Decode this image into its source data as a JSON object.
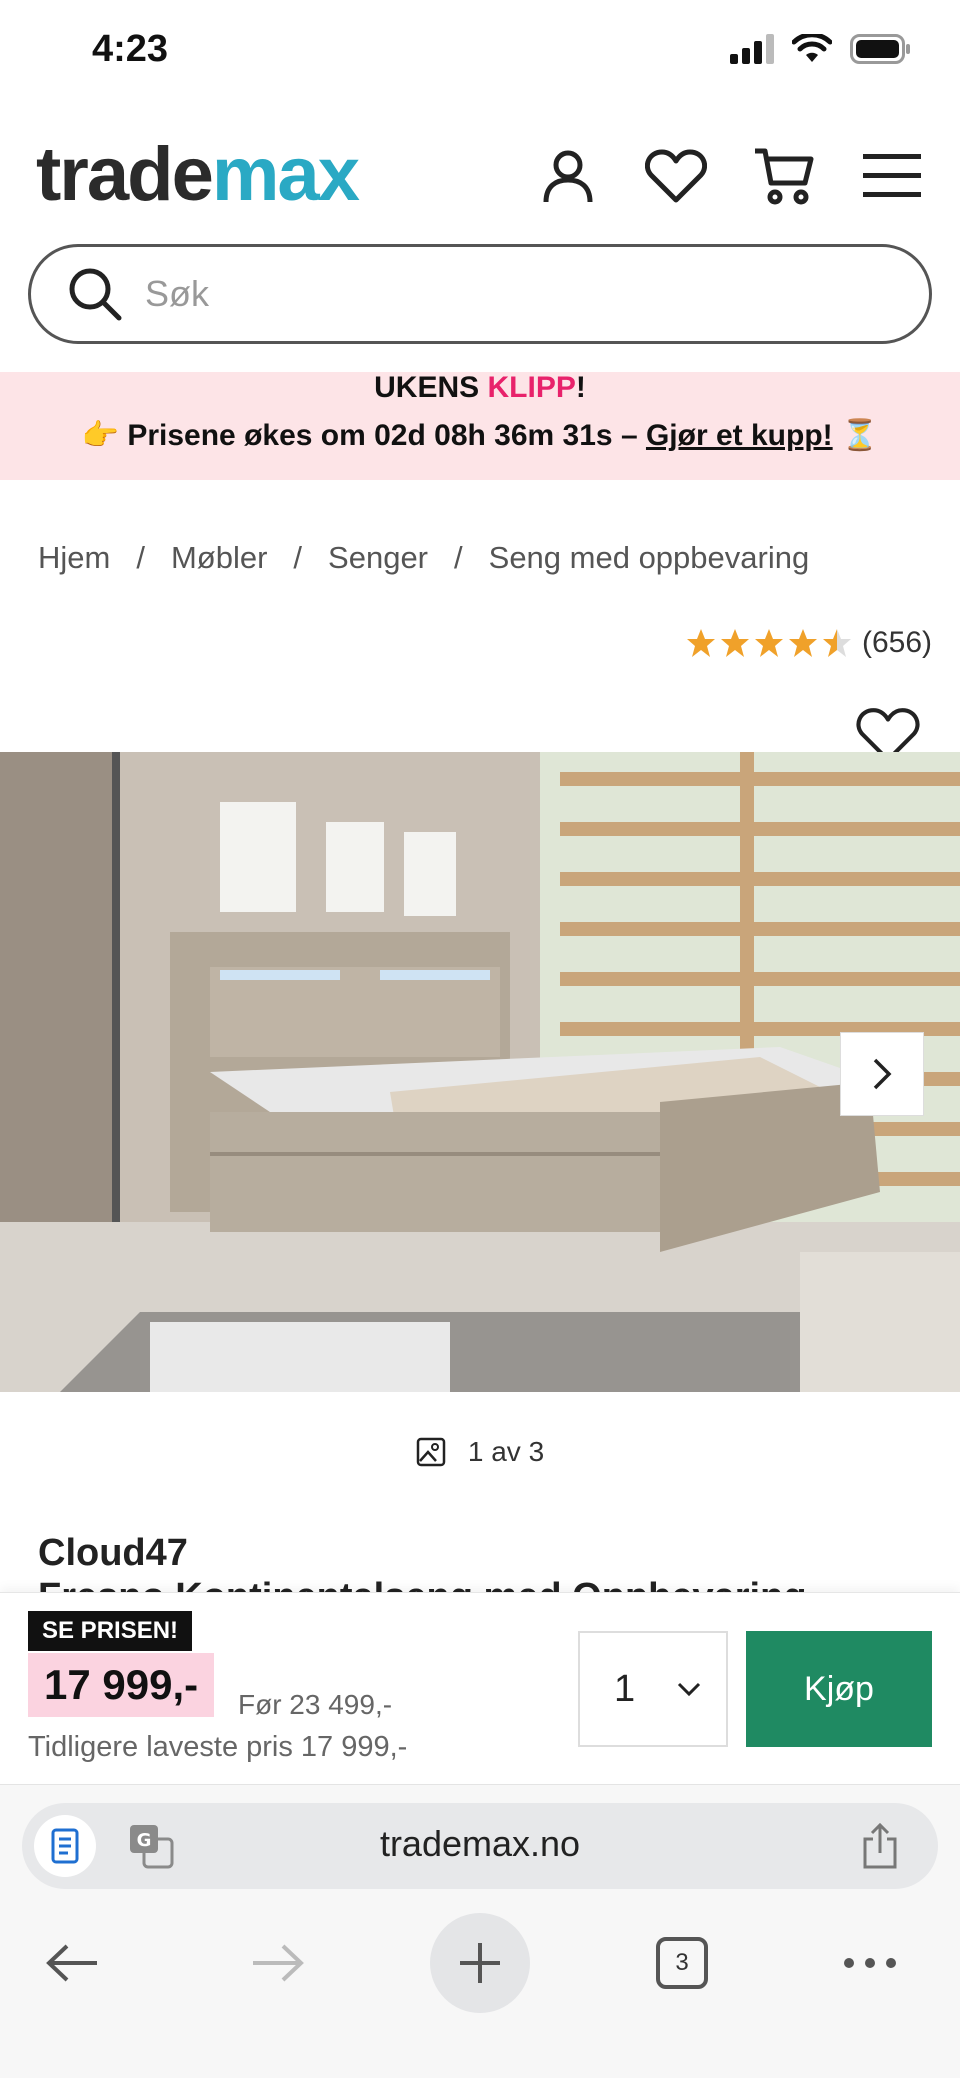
{
  "status": {
    "time": "4:23"
  },
  "header": {
    "logo_part1": "trade",
    "logo_part2": "max"
  },
  "search": {
    "placeholder": "Søk",
    "value": ""
  },
  "promo": {
    "title_part1": "UKENS ",
    "title_highlight": "KLIPP",
    "title_end": "!",
    "pointer_emoji": "👉",
    "countdown_text": " Prisene økes om 02d 08h 36m 31s – ",
    "link_label": "Gjør et kupp!",
    "hourglass_emoji": " ⏳"
  },
  "breadcrumb": [
    "Hjem",
    "Møbler",
    "Senger",
    "Seng med oppbevaring"
  ],
  "breadcrumb_separator": "/",
  "rating": {
    "stars": 4.5,
    "count": "(656)",
    "color": "#f0a12a"
  },
  "gallery": {
    "counter": "1 av 3"
  },
  "product": {
    "brand": "Cloud47",
    "title_peek": "Fresno Kontinentalseng med Oppbevaring"
  },
  "buy_bar": {
    "badge": "SE PRISEN!",
    "price": "17 999,-",
    "before": "Før 23 499,-",
    "lowest": "Tidligere laveste pris 17 999,-",
    "quantity": "1",
    "buy_label": "Kjøp",
    "buy_color": "#1f8a62"
  },
  "browser": {
    "url": "trademax.no",
    "tabs_count": "3"
  },
  "colors": {
    "brand_teal": "#2aa9c4",
    "promo_pink": "#fde4e7",
    "highlight_pink": "#e8226b"
  }
}
